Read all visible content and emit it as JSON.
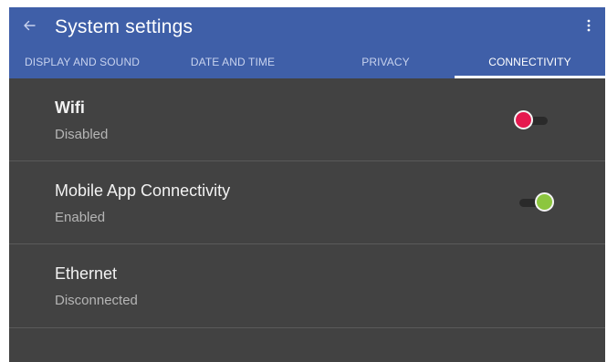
{
  "header": {
    "title": "System settings",
    "back_icon": "arrow-left-icon",
    "menu_icon": "more-vert-icon",
    "color": "#3f5fa8"
  },
  "tabs": [
    {
      "label": "DISPLAY AND SOUND"
    },
    {
      "label": "DATE AND TIME"
    },
    {
      "label": "PRIVACY"
    },
    {
      "label": "CONNECTIVITY",
      "active": true
    }
  ],
  "settings": [
    {
      "title": "Wifi",
      "status": "Disabled",
      "toggle": "off",
      "toggle_color": "#e6184f"
    },
    {
      "title": "Mobile App Connectivity",
      "status": "Enabled",
      "toggle": "on",
      "toggle_color": "#8cc63f"
    },
    {
      "title": "Ethernet",
      "status": "Disconnected"
    }
  ]
}
